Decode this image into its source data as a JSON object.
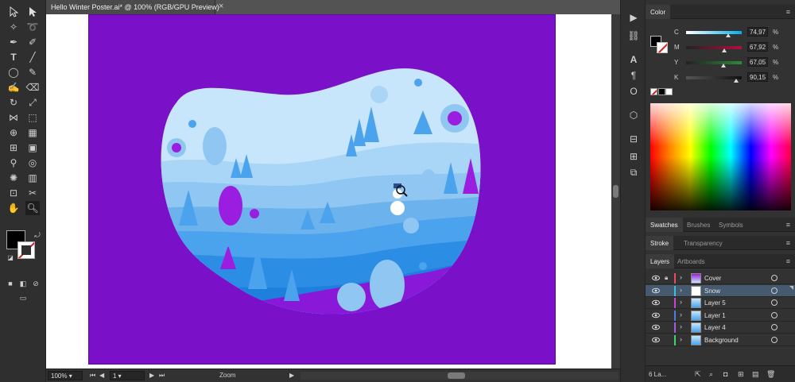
{
  "document": {
    "tab_title": "Hello Winter Poster.ai* @ 100% (RGB/GPU Preview)",
    "close_symbol": "×"
  },
  "statusbar": {
    "zoom": "100%",
    "artboard_number": "1",
    "tool_label": "Zoom"
  },
  "color_panel": {
    "title": "Color",
    "sliders": [
      {
        "label": "C",
        "value": "74,97",
        "unit": "%",
        "level": 0.75
      },
      {
        "label": "M",
        "value": "67,92",
        "unit": "%",
        "level": 0.68
      },
      {
        "label": "Y",
        "value": "67,05",
        "unit": "%",
        "level": 0.67
      },
      {
        "label": "K",
        "value": "90,15",
        "unit": "%",
        "level": 0.9
      }
    ]
  },
  "swatch_tabs": {
    "swatches": "Swatches",
    "brushes": "Brushes",
    "symbols": "Symbols"
  },
  "stroke_tabs": {
    "stroke": "Stroke",
    "transparency": "Transparency"
  },
  "layers_tabs": {
    "layers": "Layers",
    "artboards": "Artboards"
  },
  "layers": [
    {
      "name": "Cover",
      "color": "#e84c65",
      "locked": true,
      "selected": false
    },
    {
      "name": "Snow",
      "color": "#3cc1d8",
      "locked": false,
      "selected": true
    },
    {
      "name": "Layer 5",
      "color": "#c845d0",
      "locked": false,
      "selected": false
    },
    {
      "name": "Layer 1",
      "color": "#4f7ce0",
      "locked": false,
      "selected": false
    },
    {
      "name": "Layer 4",
      "color": "#9b5fe0",
      "locked": false,
      "selected": false
    },
    {
      "name": "Background",
      "color": "#3fd46a",
      "locked": false,
      "selected": false
    }
  ],
  "layers_footer": {
    "count": "6 La..."
  },
  "colors": {
    "artboard": "#7a10c8",
    "sky": "#c8e6fb",
    "hill_light": "#8fc6f2",
    "hill_mid": "#4aa3ec",
    "hill_dark": "#1e7fdc",
    "purple_ground": "#8a18d8",
    "accent_purple": "#9b1ee0"
  }
}
